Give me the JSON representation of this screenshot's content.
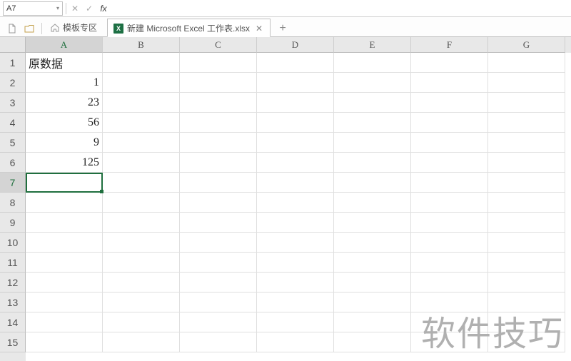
{
  "nameBox": "A7",
  "formula": "",
  "tabs": {
    "templatesLabel": "模板专区",
    "activeLabel": "新建 Microsoft Excel 工作表.xlsx"
  },
  "columns": [
    "A",
    "B",
    "C",
    "D",
    "E",
    "F",
    "G"
  ],
  "rows": [
    "1",
    "2",
    "3",
    "4",
    "5",
    "6",
    "7",
    "8",
    "9",
    "10",
    "11",
    "12",
    "13",
    "14",
    "15"
  ],
  "activeCell": {
    "row": 7,
    "col": "A"
  },
  "cells": {
    "A1": "原数据",
    "A2": "1",
    "A3": "23",
    "A4": "56",
    "A5": "9",
    "A6": "125"
  },
  "watermark": "软件技巧",
  "icons": {
    "excelBadge": "X"
  }
}
